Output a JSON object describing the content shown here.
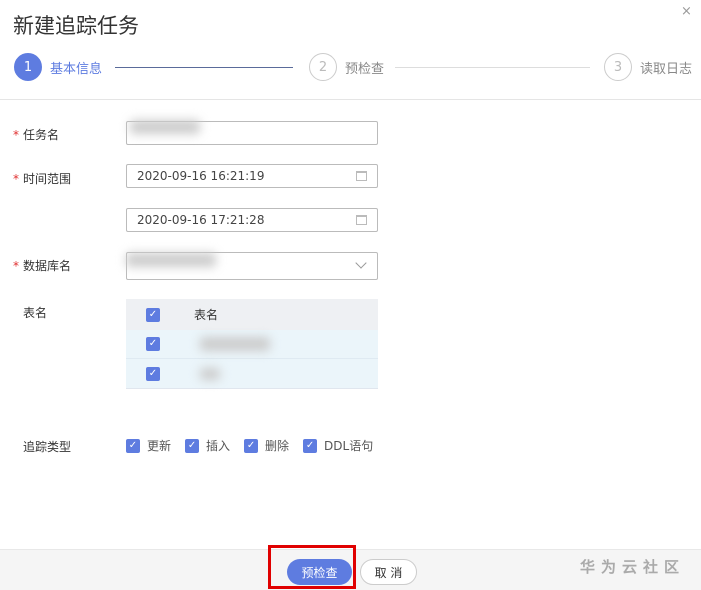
{
  "dialog": {
    "title": "新建追踪任务",
    "close_icon": "×"
  },
  "steps": [
    {
      "num": "1",
      "label": "基本信息"
    },
    {
      "num": "2",
      "label": "预检查"
    },
    {
      "num": "3",
      "label": "读取日志"
    }
  ],
  "form": {
    "required_mark": "*",
    "task_name_label": "任务名",
    "time_range_label": "时间范围",
    "start_time": "2020-09-16 16:21:19",
    "end_time": "2020-09-16 17:21:28",
    "db_name_label": "数据库名",
    "table_label": "表名",
    "table_header": "表名",
    "track_type_label": "追踪类型",
    "track_types": [
      {
        "label": "更新",
        "checked": true
      },
      {
        "label": "插入",
        "checked": true
      },
      {
        "label": "删除",
        "checked": true
      },
      {
        "label": "DDL语句",
        "checked": true
      }
    ]
  },
  "footer": {
    "precheck": "预检查",
    "cancel": "取 消",
    "watermark": "华为云社区"
  },
  "colors": {
    "accent": "#5e7ce0",
    "highlight": "#e00000"
  }
}
